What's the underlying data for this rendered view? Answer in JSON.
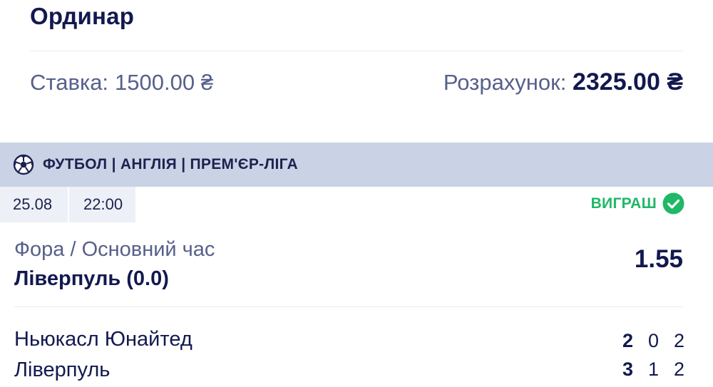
{
  "bet": {
    "type": "Ординар",
    "stake_label": "Ставка:",
    "stake_value": "1500.00 ₴",
    "payout_label": "Розрахунок:",
    "payout_value": "2325.00 ₴"
  },
  "event": {
    "sport_path": "ФУТБОЛ | АНГЛІЯ | ПРЕМ'ЄР-ЛІГА",
    "sport_icon": "soccer-ball-icon",
    "date": "25.08",
    "time": "22:00",
    "result_label": "ВИГРАШ",
    "result_icon": "check-circle-icon",
    "market": "Фора / Основний час",
    "selection": "Ліверпуль (0.0)",
    "odds": "1.55"
  },
  "teams": [
    {
      "name": "Ньюкасл Юнайтед",
      "total": "2",
      "half1": "0",
      "half2": "2"
    },
    {
      "name": "Ліверпуль",
      "total": "3",
      "half1": "1",
      "half2": "2"
    }
  ],
  "colors": {
    "primary_text": "#12194f",
    "secondary_text": "#57608a",
    "sport_bar": "#c9d3e5",
    "chip_bg": "#edf0f6",
    "win_green": "#1fb866"
  }
}
